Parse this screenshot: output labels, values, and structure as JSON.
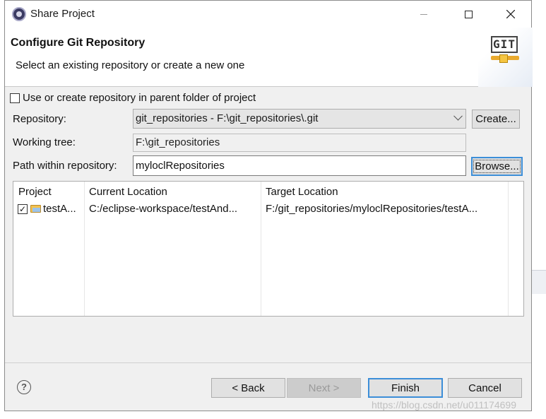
{
  "window": {
    "title": "Share Project"
  },
  "header": {
    "title": "Configure Git Repository",
    "description": "Select an existing repository or create a new one",
    "logo_text": "GIT"
  },
  "form": {
    "parent_folder_label": "Use or create repository in parent folder of project",
    "parent_folder_checked": false,
    "repository_label": "Repository:",
    "repository_value": "git_repositories - F:\\git_repositories\\.git",
    "create_label": "Create...",
    "working_tree_label": "Working tree:",
    "working_tree_value": "F:\\git_repositories",
    "path_label": "Path within repository:",
    "path_value": "myloclRepositories",
    "browse_label": "Browse..."
  },
  "table": {
    "columns": [
      "Project",
      "Current Location",
      "Target Location"
    ],
    "rows": [
      {
        "checked": true,
        "project": "testA...",
        "current_location": "C:/eclipse-workspace/testAnd...",
        "target_location": "F:/git_repositories/myloclRepositories/testA..."
      }
    ]
  },
  "footer": {
    "back_label": "< Back",
    "next_label": "Next >",
    "finish_label": "Finish",
    "cancel_label": "Cancel"
  },
  "watermark": "https://blog.csdn.net/u011174699"
}
